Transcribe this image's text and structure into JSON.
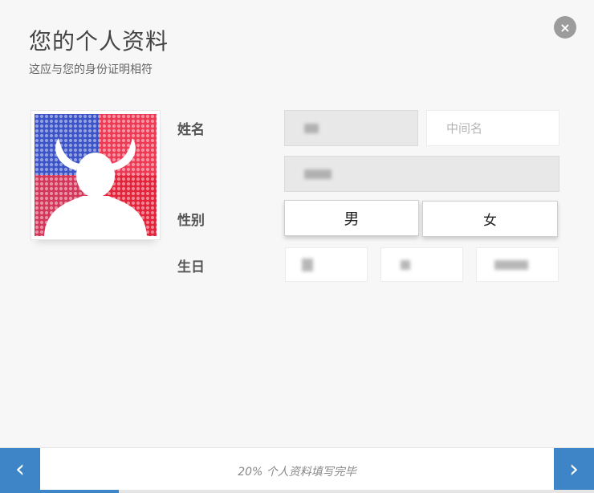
{
  "header": {
    "title": "您的个人资料",
    "subtitle": "这应与您的身份证明相符",
    "close_icon": "×"
  },
  "form": {
    "name_label": "姓名",
    "middle_name_placeholder": "中间名",
    "gender_label": "性别",
    "gender_male": "男",
    "gender_female": "女",
    "birth_label": "生日"
  },
  "footer": {
    "prev_icon": "‹",
    "next_icon": "›",
    "progress_text": "20% 个人资料填写完毕",
    "progress_fraction": 0.2
  },
  "colors": {
    "accent": "#3d85c6",
    "avatar_blue": "#3b53c6",
    "avatar_red": "#e2233a"
  }
}
